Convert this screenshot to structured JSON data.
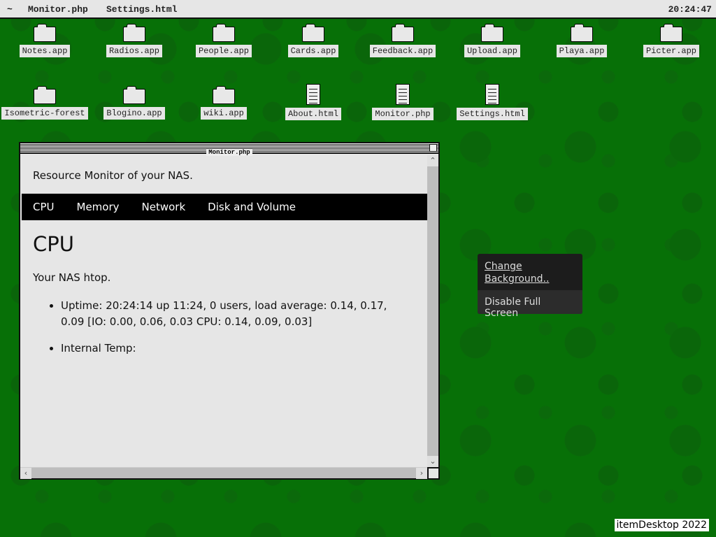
{
  "topbar": {
    "home": "~",
    "items": [
      "Monitor.php",
      "Settings.html"
    ],
    "clock": "20:24:47"
  },
  "desktop": {
    "icons": [
      {
        "label": "Notes.app",
        "type": "folder"
      },
      {
        "label": "Radios.app",
        "type": "folder"
      },
      {
        "label": "People.app",
        "type": "folder"
      },
      {
        "label": "Cards.app",
        "type": "folder"
      },
      {
        "label": "Feedback.app",
        "type": "folder"
      },
      {
        "label": "Upload.app",
        "type": "folder"
      },
      {
        "label": "Playa.app",
        "type": "folder"
      },
      {
        "label": "Picter.app",
        "type": "folder"
      },
      {
        "label": "Isometric-forest",
        "type": "folder"
      },
      {
        "label": "Blogino.app",
        "type": "folder"
      },
      {
        "label": "wiki.app",
        "type": "folder"
      },
      {
        "label": "About.html",
        "type": "document"
      },
      {
        "label": "Monitor.php",
        "type": "document"
      },
      {
        "label": "Settings.html",
        "type": "document"
      }
    ]
  },
  "window": {
    "title": "Monitor.php",
    "header": "Resource Monitor of your NAS.",
    "nav": [
      "CPU",
      "Memory",
      "Network",
      "Disk and Volume"
    ],
    "heading": "CPU",
    "intro": "Your NAS htop.",
    "bullets": [
      "Uptime: 20:24:14 up 11:24, 0 users, load average: 0.14, 0.17, 0.09 [IO: 0.00, 0.06, 0.03 CPU: 0.14, 0.09, 0.03]",
      "Internal Temp:"
    ]
  },
  "context_menu": {
    "items": [
      "Change Background..",
      "Disable Full Screen"
    ]
  },
  "credit": "itemDesktop 2022"
}
